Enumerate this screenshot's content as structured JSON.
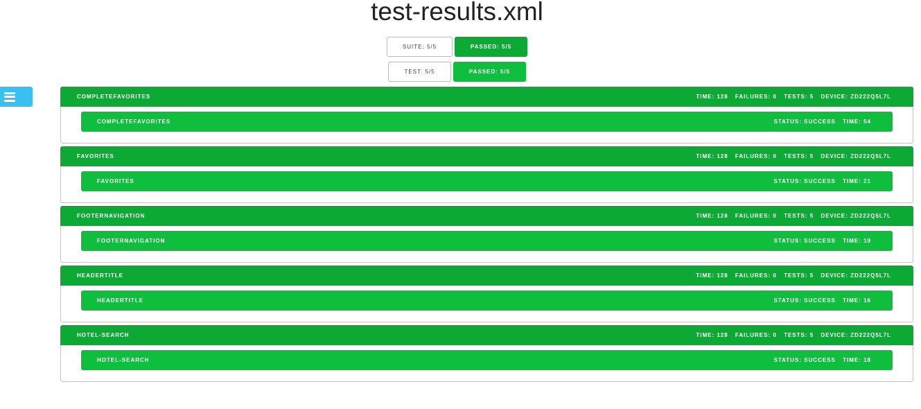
{
  "title": "test-results.xml",
  "colors": {
    "suite_green": "#0caa34",
    "test_green": "#0fbe3c",
    "menu_blue": "#38c1f0"
  },
  "summary": {
    "suite_label": "SUITE: 5/5",
    "suite_passed": "PASSED: 5/5",
    "test_label": "TEST: 5/5",
    "test_passed": "PASSED: 5/5"
  },
  "menu": {
    "icon": "hamburger-menu-icon"
  },
  "suites": [
    {
      "name": "COMPLETEFAVORITES",
      "time": "TIME: 128",
      "failures": "FAILURES: 0",
      "tests": "TESTS: 5",
      "device": "DEVICE: ZD222Q5L7L",
      "test": {
        "name": "COMPLETEFAVORITES",
        "status": "STATUS: SUCCESS",
        "time": "TIME: 54"
      }
    },
    {
      "name": "FAVORITES",
      "time": "TIME: 128",
      "failures": "FAILURES: 0",
      "tests": "TESTS: 5",
      "device": "DEVICE: ZD222Q5L7L",
      "test": {
        "name": "FAVORITES",
        "status": "STATUS: SUCCESS",
        "time": "TIME: 21"
      }
    },
    {
      "name": "FOOTERNAVIGATION",
      "time": "TIME: 128",
      "failures": "FAILURES: 0",
      "tests": "TESTS: 5",
      "device": "DEVICE: ZD222Q5L7L",
      "test": {
        "name": "FOOTERNAVIGATION",
        "status": "STATUS: SUCCESS",
        "time": "TIME: 19"
      }
    },
    {
      "name": "HEADERTITLE",
      "time": "TIME: 128",
      "failures": "FAILURES: 0",
      "tests": "TESTS: 5",
      "device": "DEVICE: ZD222Q5L7L",
      "test": {
        "name": "HEADERTITLE",
        "status": "STATUS: SUCCESS",
        "time": "TIME: 16"
      }
    },
    {
      "name": "HOTEL-SEARCH",
      "time": "TIME: 128",
      "failures": "FAILURES: 0",
      "tests": "TESTS: 5",
      "device": "DEVICE: ZD222Q5L7L",
      "test": {
        "name": "HOTEL-SEARCH",
        "status": "STATUS: SUCCESS",
        "time": "TIME: 18"
      }
    }
  ]
}
